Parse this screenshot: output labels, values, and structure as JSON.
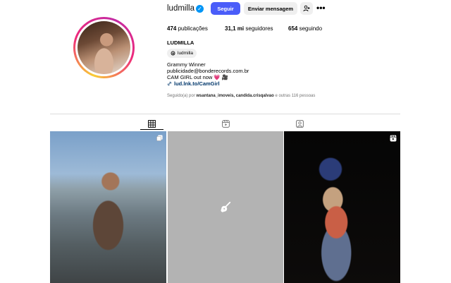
{
  "profile": {
    "username": "ludmilla",
    "verified_glyph": "✓",
    "follow_label": "Seguir",
    "message_label": "Enviar mensagem",
    "more_label": "•••",
    "stats": {
      "posts_value": "474",
      "posts_label": "publicações",
      "followers_value": "31,1 mi",
      "followers_label": "seguidores",
      "following_value": "654",
      "following_label": "seguindo"
    },
    "full_name": "LUDMILLA",
    "threads_handle": "ludmilla",
    "bio": {
      "line1": "Grammy Winner",
      "line2": "publicidade@bonderecords.com.br",
      "line3": "CAM GIRL out now 💗 🎥"
    },
    "link": "lud.lnk.to/CamGirl",
    "followed_by": {
      "prefix": "Seguido(a) por",
      "users": "wsantana_imoveis, candida.crisqalvao",
      "suffix": "e outras 116 pessoas"
    }
  },
  "icons": {
    "verified": "verified-badge-icon",
    "suggest": "add-person-icon",
    "threads": "threads-icon",
    "link": "link-icon",
    "tab_posts": "grid-icon",
    "tab_reels": "reels-icon",
    "tab_tagged": "tagged-icon",
    "carousel": "carousel-icon",
    "reel": "reel-icon",
    "guitar": "guitar-icon"
  },
  "colors": {
    "accent": "#4a5df9",
    "verified": "#0095f6",
    "link": "#00376b",
    "secondary_text": "#737373"
  }
}
